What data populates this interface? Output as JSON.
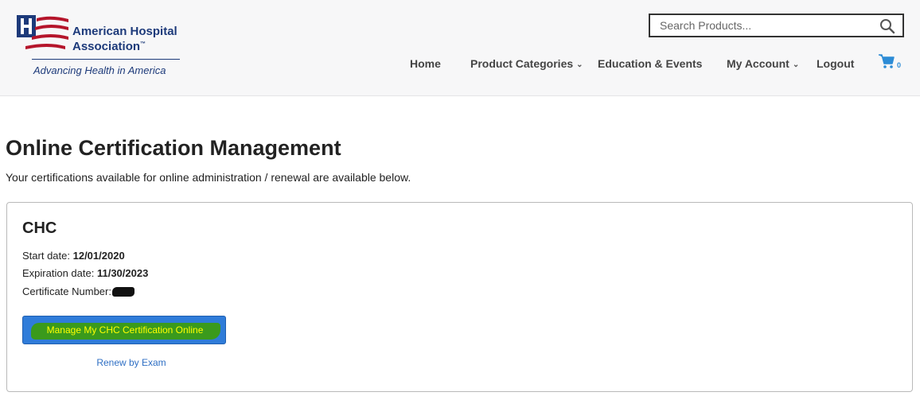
{
  "header": {
    "logo": {
      "name_line1": "American Hospital",
      "name_line2": "Association",
      "trademark": "™",
      "tagline": "Advancing Health in America"
    },
    "search": {
      "placeholder": "Search Products..."
    },
    "nav": {
      "home": "Home",
      "product_categories": "Product Categories",
      "education_events": "Education & Events",
      "my_account": "My Account",
      "logout": "Logout"
    },
    "cart": {
      "count": "0"
    }
  },
  "main": {
    "title": "Online Certification Management",
    "intro": "Your certifications available for online administration / renewal are available below.",
    "certification": {
      "name": "CHC",
      "start_label": "Start date:",
      "start_value": "12/01/2020",
      "expiration_label": "Expiration date:",
      "expiration_value": "11/30/2023",
      "certificate_number_label": "Certificate Number:",
      "manage_button": "Manage My CHC Certification Online",
      "renew_link": "Renew by Exam"
    }
  },
  "colors": {
    "brand_navy": "#1d3a7a",
    "brand_red": "#b5152b",
    "button_blue": "#2f7cd9",
    "link_blue": "#2f6fc4",
    "highlight_green": "#3a9a1c",
    "highlight_text": "#ffff00"
  },
  "icons": [
    "aha-logo-icon",
    "search-icon",
    "chevron-down-icon",
    "cart-icon"
  ]
}
